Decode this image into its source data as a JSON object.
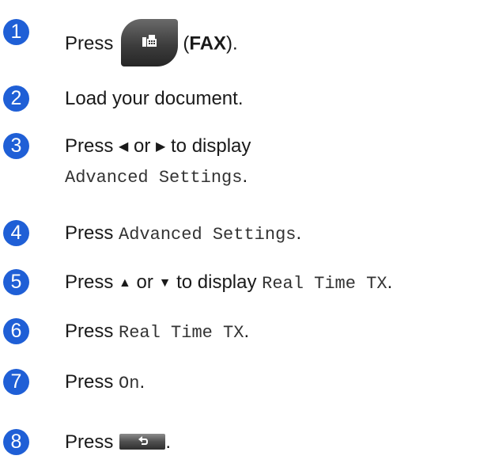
{
  "steps": [
    {
      "number": "1",
      "text_before": "Press",
      "text_after_open": "(",
      "key": "FAX",
      "text_after_close": ")."
    },
    {
      "number": "2",
      "text": "Load your document."
    },
    {
      "number": "3",
      "text_before": "Press",
      "or": "or",
      "text_after": "to display",
      "setting": "Advanced Settings",
      "period": "."
    },
    {
      "number": "4",
      "text_before": "Press",
      "setting": "Advanced Settings",
      "period": "."
    },
    {
      "number": "5",
      "text_before": "Press",
      "or": "or",
      "text_after": "to display",
      "setting": "Real Time TX",
      "period": "."
    },
    {
      "number": "6",
      "text_before": "Press",
      "setting": "Real Time TX",
      "period": "."
    },
    {
      "number": "7",
      "text_before": "Press",
      "setting": "On",
      "period": "."
    },
    {
      "number": "8",
      "text_before": "Press",
      "period": "."
    }
  ],
  "icons": {
    "fax_button": "fax-icon",
    "back_button": "back-arrow-icon",
    "left_arrow": "left-triangle-icon",
    "right_arrow": "right-triangle-icon",
    "up_arrow": "up-triangle-icon",
    "down_arrow": "down-triangle-icon"
  },
  "colors": {
    "badge": "#1f5fd6",
    "button_dark": "#3d3d3d"
  }
}
